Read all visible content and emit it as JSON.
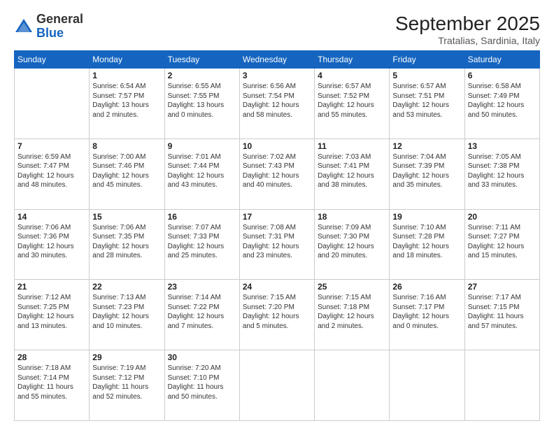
{
  "logo": {
    "general": "General",
    "blue": "Blue"
  },
  "header": {
    "month": "September 2025",
    "location": "Tratalias, Sardinia, Italy"
  },
  "weekdays": [
    "Sunday",
    "Monday",
    "Tuesday",
    "Wednesday",
    "Thursday",
    "Friday",
    "Saturday"
  ],
  "weeks": [
    [
      {
        "day": "",
        "sunrise": "",
        "sunset": "",
        "daylight": ""
      },
      {
        "day": "1",
        "sunrise": "Sunrise: 6:54 AM",
        "sunset": "Sunset: 7:57 PM",
        "daylight": "Daylight: 13 hours and 2 minutes."
      },
      {
        "day": "2",
        "sunrise": "Sunrise: 6:55 AM",
        "sunset": "Sunset: 7:55 PM",
        "daylight": "Daylight: 13 hours and 0 minutes."
      },
      {
        "day": "3",
        "sunrise": "Sunrise: 6:56 AM",
        "sunset": "Sunset: 7:54 PM",
        "daylight": "Daylight: 12 hours and 58 minutes."
      },
      {
        "day": "4",
        "sunrise": "Sunrise: 6:57 AM",
        "sunset": "Sunset: 7:52 PM",
        "daylight": "Daylight: 12 hours and 55 minutes."
      },
      {
        "day": "5",
        "sunrise": "Sunrise: 6:57 AM",
        "sunset": "Sunset: 7:51 PM",
        "daylight": "Daylight: 12 hours and 53 minutes."
      },
      {
        "day": "6",
        "sunrise": "Sunrise: 6:58 AM",
        "sunset": "Sunset: 7:49 PM",
        "daylight": "Daylight: 12 hours and 50 minutes."
      }
    ],
    [
      {
        "day": "7",
        "sunrise": "Sunrise: 6:59 AM",
        "sunset": "Sunset: 7:47 PM",
        "daylight": "Daylight: 12 hours and 48 minutes."
      },
      {
        "day": "8",
        "sunrise": "Sunrise: 7:00 AM",
        "sunset": "Sunset: 7:46 PM",
        "daylight": "Daylight: 12 hours and 45 minutes."
      },
      {
        "day": "9",
        "sunrise": "Sunrise: 7:01 AM",
        "sunset": "Sunset: 7:44 PM",
        "daylight": "Daylight: 12 hours and 43 minutes."
      },
      {
        "day": "10",
        "sunrise": "Sunrise: 7:02 AM",
        "sunset": "Sunset: 7:43 PM",
        "daylight": "Daylight: 12 hours and 40 minutes."
      },
      {
        "day": "11",
        "sunrise": "Sunrise: 7:03 AM",
        "sunset": "Sunset: 7:41 PM",
        "daylight": "Daylight: 12 hours and 38 minutes."
      },
      {
        "day": "12",
        "sunrise": "Sunrise: 7:04 AM",
        "sunset": "Sunset: 7:39 PM",
        "daylight": "Daylight: 12 hours and 35 minutes."
      },
      {
        "day": "13",
        "sunrise": "Sunrise: 7:05 AM",
        "sunset": "Sunset: 7:38 PM",
        "daylight": "Daylight: 12 hours and 33 minutes."
      }
    ],
    [
      {
        "day": "14",
        "sunrise": "Sunrise: 7:06 AM",
        "sunset": "Sunset: 7:36 PM",
        "daylight": "Daylight: 12 hours and 30 minutes."
      },
      {
        "day": "15",
        "sunrise": "Sunrise: 7:06 AM",
        "sunset": "Sunset: 7:35 PM",
        "daylight": "Daylight: 12 hours and 28 minutes."
      },
      {
        "day": "16",
        "sunrise": "Sunrise: 7:07 AM",
        "sunset": "Sunset: 7:33 PM",
        "daylight": "Daylight: 12 hours and 25 minutes."
      },
      {
        "day": "17",
        "sunrise": "Sunrise: 7:08 AM",
        "sunset": "Sunset: 7:31 PM",
        "daylight": "Daylight: 12 hours and 23 minutes."
      },
      {
        "day": "18",
        "sunrise": "Sunrise: 7:09 AM",
        "sunset": "Sunset: 7:30 PM",
        "daylight": "Daylight: 12 hours and 20 minutes."
      },
      {
        "day": "19",
        "sunrise": "Sunrise: 7:10 AM",
        "sunset": "Sunset: 7:28 PM",
        "daylight": "Daylight: 12 hours and 18 minutes."
      },
      {
        "day": "20",
        "sunrise": "Sunrise: 7:11 AM",
        "sunset": "Sunset: 7:27 PM",
        "daylight": "Daylight: 12 hours and 15 minutes."
      }
    ],
    [
      {
        "day": "21",
        "sunrise": "Sunrise: 7:12 AM",
        "sunset": "Sunset: 7:25 PM",
        "daylight": "Daylight: 12 hours and 13 minutes."
      },
      {
        "day": "22",
        "sunrise": "Sunrise: 7:13 AM",
        "sunset": "Sunset: 7:23 PM",
        "daylight": "Daylight: 12 hours and 10 minutes."
      },
      {
        "day": "23",
        "sunrise": "Sunrise: 7:14 AM",
        "sunset": "Sunset: 7:22 PM",
        "daylight": "Daylight: 12 hours and 7 minutes."
      },
      {
        "day": "24",
        "sunrise": "Sunrise: 7:15 AM",
        "sunset": "Sunset: 7:20 PM",
        "daylight": "Daylight: 12 hours and 5 minutes."
      },
      {
        "day": "25",
        "sunrise": "Sunrise: 7:15 AM",
        "sunset": "Sunset: 7:18 PM",
        "daylight": "Daylight: 12 hours and 2 minutes."
      },
      {
        "day": "26",
        "sunrise": "Sunrise: 7:16 AM",
        "sunset": "Sunset: 7:17 PM",
        "daylight": "Daylight: 12 hours and 0 minutes."
      },
      {
        "day": "27",
        "sunrise": "Sunrise: 7:17 AM",
        "sunset": "Sunset: 7:15 PM",
        "daylight": "Daylight: 11 hours and 57 minutes."
      }
    ],
    [
      {
        "day": "28",
        "sunrise": "Sunrise: 7:18 AM",
        "sunset": "Sunset: 7:14 PM",
        "daylight": "Daylight: 11 hours and 55 minutes."
      },
      {
        "day": "29",
        "sunrise": "Sunrise: 7:19 AM",
        "sunset": "Sunset: 7:12 PM",
        "daylight": "Daylight: 11 hours and 52 minutes."
      },
      {
        "day": "30",
        "sunrise": "Sunrise: 7:20 AM",
        "sunset": "Sunset: 7:10 PM",
        "daylight": "Daylight: 11 hours and 50 minutes."
      },
      {
        "day": "",
        "sunrise": "",
        "sunset": "",
        "daylight": ""
      },
      {
        "day": "",
        "sunrise": "",
        "sunset": "",
        "daylight": ""
      },
      {
        "day": "",
        "sunrise": "",
        "sunset": "",
        "daylight": ""
      },
      {
        "day": "",
        "sunrise": "",
        "sunset": "",
        "daylight": ""
      }
    ]
  ]
}
